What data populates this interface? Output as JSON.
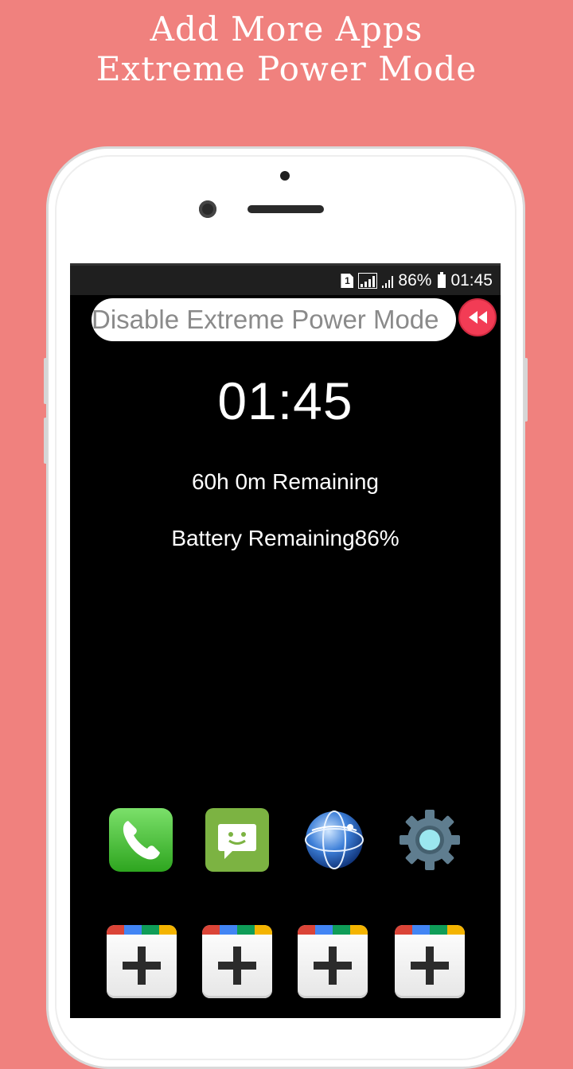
{
  "promo": {
    "line1": "Add More Apps",
    "line2": "Extreme Power Mode"
  },
  "status_bar": {
    "sim_label": "1",
    "battery_percent": "86%",
    "time": "01:45"
  },
  "disable_button_label": "Disable Extreme Power Mode",
  "clock": "01:45",
  "time_remaining": "60h 0m Remaining",
  "battery_remaining": "Battery Remaining86%",
  "apps": [
    {
      "icon": "phone-icon"
    },
    {
      "icon": "messages-icon"
    },
    {
      "icon": "browser-globe-icon"
    },
    {
      "icon": "settings-gear-icon"
    }
  ],
  "add_slots": 4,
  "colors": {
    "background": "#f0817e",
    "rewind_button": "#f23c55",
    "screen": "#000000",
    "add_stripe": [
      "#db4437",
      "#4285f4",
      "#0f9d58",
      "#f4b400"
    ]
  }
}
